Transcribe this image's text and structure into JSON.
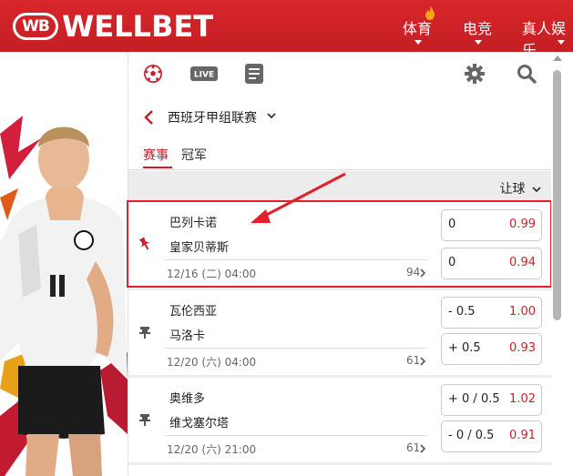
{
  "header": {
    "logo_mark": "WB",
    "logo_text": "WELLBET",
    "nav": [
      "体育",
      "电竞",
      "真人娱乐"
    ]
  },
  "toolbar": {
    "icons": [
      "soccer-ball-icon",
      "live-icon",
      "betslip-icon",
      "gear-icon",
      "search-icon"
    ],
    "live_label": "LIVE"
  },
  "breadcrumb": {
    "label": "西班牙甲组联赛"
  },
  "tabs": [
    {
      "label": "赛事",
      "active": true
    },
    {
      "label": "冠军",
      "active": false
    }
  ],
  "sort": {
    "label": "让球"
  },
  "matches": [
    {
      "home": "巴列卡诺",
      "away": "皇家贝蒂斯",
      "date": "12/16 (二) 04:00",
      "markets": "94",
      "pinned": true,
      "odds": [
        {
          "line": "0",
          "price": "0.99"
        },
        {
          "line": "0",
          "price": "0.94"
        }
      ]
    },
    {
      "home": "瓦伦西亚",
      "away": "马洛卡",
      "date": "12/20 (六) 04:00",
      "markets": "61",
      "pinned": false,
      "odds": [
        {
          "line": "- 0.5",
          "price": "1.00"
        },
        {
          "line": "+ 0.5",
          "price": "0.93"
        }
      ]
    },
    {
      "home": "奥维多",
      "away": "维戈塞尔塔",
      "date": "12/20 (六) 21:00",
      "markets": "61",
      "pinned": false,
      "odds": [
        {
          "line": "+ 0 / 0.5",
          "price": "1.02"
        },
        {
          "line": "- 0 / 0.5",
          "price": "0.91"
        }
      ]
    }
  ],
  "colors": {
    "brand": "#c41f24",
    "accent": "#c8202a",
    "highlight": "#e0202d"
  }
}
